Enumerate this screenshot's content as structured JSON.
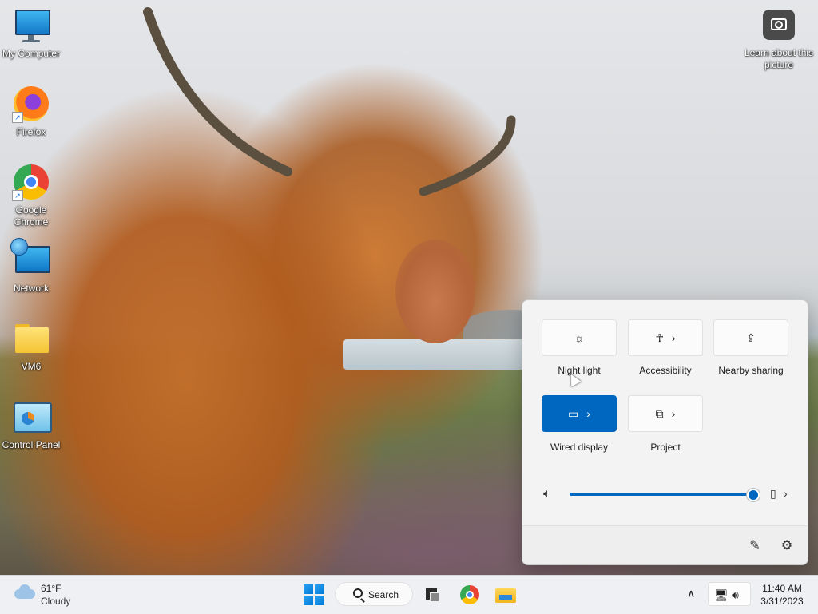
{
  "desktop": {
    "icons": [
      {
        "label": "My Computer",
        "icon": "monitor-icon"
      },
      {
        "label": "Firefox",
        "icon": "firefox-icon"
      },
      {
        "label": "Google Chrome",
        "icon": "chrome-icon"
      },
      {
        "label": "Network",
        "icon": "network-icon"
      },
      {
        "label": "VM6",
        "icon": "folder-icon"
      },
      {
        "label": "Control Panel",
        "icon": "control-panel-icon"
      }
    ],
    "learn_about_picture": {
      "label": "Learn about this picture",
      "icon": "camera-icon"
    }
  },
  "quick_settings": {
    "tiles": [
      {
        "label": "Night light",
        "icon": "night-light-icon",
        "active": false,
        "has_chevron": false
      },
      {
        "label": "Accessibility",
        "icon": "accessibility-icon",
        "active": false,
        "has_chevron": true
      },
      {
        "label": "Nearby sharing",
        "icon": "nearby-sharing-icon",
        "active": false,
        "has_chevron": false
      },
      {
        "label": "Wired display",
        "icon": "wired-display-icon",
        "active": true,
        "has_chevron": true
      },
      {
        "label": "Project",
        "icon": "project-icon",
        "active": false,
        "has_chevron": true
      }
    ],
    "volume": {
      "level": 1.0,
      "icon": "speaker-icon",
      "device_icon": "audio-device-icon"
    },
    "footer": {
      "edit_icon": "pencil-icon",
      "settings_icon": "gear-icon"
    }
  },
  "taskbar": {
    "weather": {
      "temp": "61°F",
      "desc": "Cloudy",
      "icon": "cloud-icon"
    },
    "search_label": "Search",
    "pinned": [
      "task-view",
      "chrome",
      "file-explorer"
    ],
    "clock": {
      "time": "11:40 AM",
      "date": "3/31/2023"
    }
  },
  "colors": {
    "accent": "#0067c0",
    "panel_bg": "#f3f3f3",
    "taskbar_bg": "#eef0f3"
  }
}
